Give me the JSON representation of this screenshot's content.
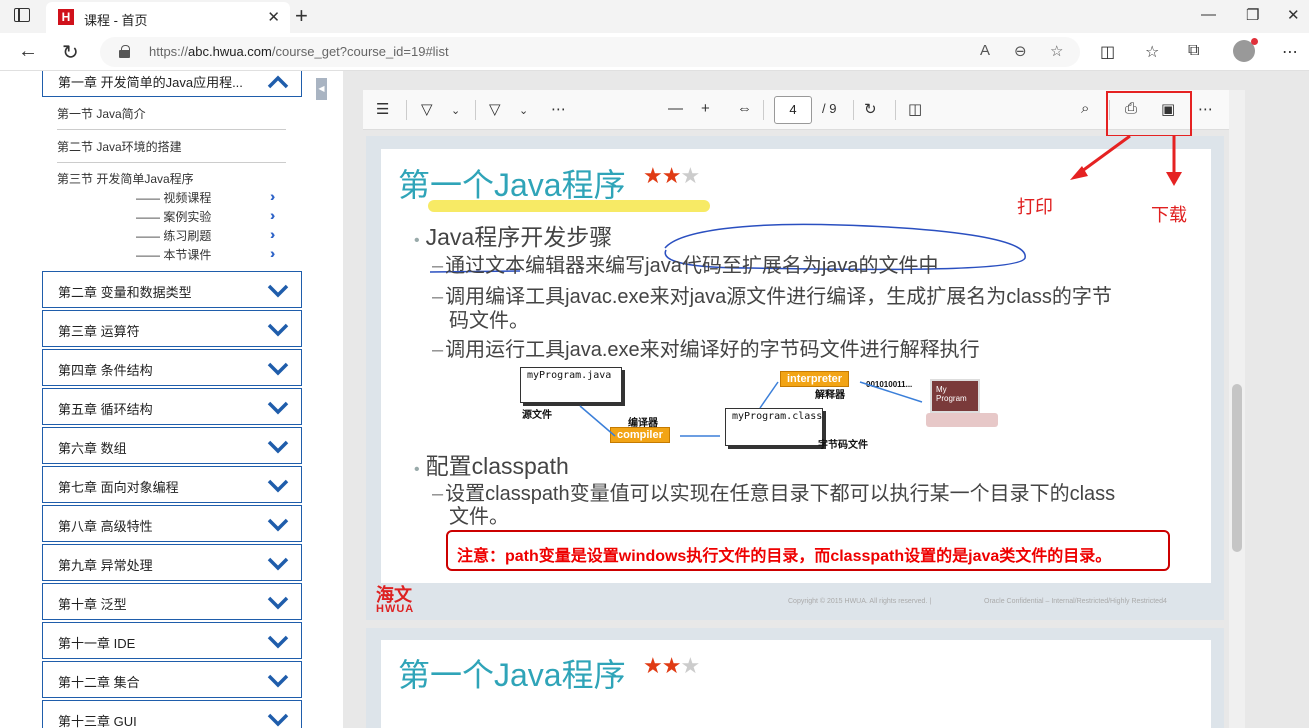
{
  "browser": {
    "tab_title": "课程 - 首页",
    "tab_favicon_text": "H",
    "url_prefix": "https://",
    "url_host": "abc.hwua.com",
    "url_path": "/course_get?course_id=19#list"
  },
  "sidebar": {
    "open_chapter": "第一章 开发简单的Java应用程...",
    "sections": [
      "第一节 Java简介",
      "第二节 Java环境的搭建",
      "第三节 开发简单Java程序"
    ],
    "subitems": [
      "—— 视频课程",
      "—— 案例实验",
      "—— 练习刷题",
      "—— 本节课件"
    ],
    "chapters": [
      "第二章 变量和数据类型",
      "第三章 运算符",
      "第四章 条件结构",
      "第五章 循环结构",
      "第六章 数组",
      "第七章 面向对象编程",
      "第八章 高级特性",
      "第九章 异常处理",
      "第十章 泛型",
      "第十一章 IDE",
      "第十二章 集合",
      "第十三章 GUI"
    ]
  },
  "pdf_toolbar": {
    "current_page": "4",
    "total_pages": "/ 9"
  },
  "slide": {
    "title": "第一个Java程序",
    "stars_filled": "★★",
    "stars_empty": "★",
    "bullet1": "Java程序开发步骤",
    "item1": "通过文本编辑器来编写java代码至扩展名为java的文件中",
    "item2_line1": "调用编译工具javac.exe来对java源文件进行编译，生成扩展名为class的字节",
    "item2_line2": "码文件。",
    "item3": "调用运行工具java.exe来对编译好的字节码文件进行解释执行",
    "diagram": {
      "source_file": "myProgram.java",
      "source_label": "源文件",
      "compiler_label": "编译器",
      "compiler": "compiler",
      "class_file": "myProgram.class",
      "bytecode_label": "字节码文件",
      "interpreter": "interpreter",
      "interpreter_label": "解释器",
      "binary": "001010011...",
      "screen_text": "My Program"
    },
    "bullet2": "配置classpath",
    "item4_line1": "设置classpath变量值可以实现在任意目录下都可以执行某一个目录下的class",
    "item4_line2": "文件。",
    "note": "注意：path变量是设置windows执行文件的目录，而classpath设置的是java类文件的目录。",
    "logo_top": "海文",
    "logo_bottom": "HWUA",
    "copyright": "Copyright © 2015 HWUA. All rights reserved.   |",
    "confidential": "Oracle Confidential – Internal/Restricted/Highly Restricted4"
  },
  "annotations": {
    "print": "打印",
    "download": "下载"
  },
  "slide2": {
    "title": "第一个Java程序",
    "stars_filled": "★★",
    "stars_empty": "★"
  },
  "colors": {
    "accent_blue": "#1f5dab",
    "title_teal": "#2fa4b8",
    "annotation_red": "#e02020"
  }
}
